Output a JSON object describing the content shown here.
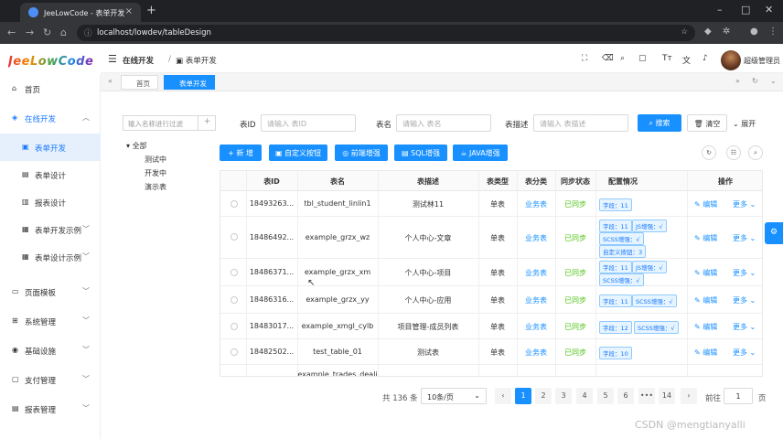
{
  "browser": {
    "tab_title": "JeeLowCode - 表单开发",
    "url": "localhost/lowdev/tableDesign"
  },
  "app": {
    "logo": "JeeLowCode",
    "breadcrumb": [
      "在线开发",
      "表单开发"
    ],
    "user_name": "超级管理员",
    "page_tabs": [
      "首页",
      "表单开发"
    ],
    "accent_color": "#1890ff"
  },
  "sidebar": {
    "items": [
      {
        "label": "首页",
        "icon": "home-icon"
      },
      {
        "label": "在线开发",
        "icon": "layers-icon",
        "expanded": true
      },
      {
        "label": "表单开发",
        "icon": "form-icon",
        "active": true
      },
      {
        "label": "表单设计",
        "icon": "design-icon"
      },
      {
        "label": "报表设计",
        "icon": "report-icon"
      },
      {
        "label": "表单开发示例",
        "icon": "grid-icon"
      },
      {
        "label": "表单设计示例",
        "icon": "grid-icon"
      },
      {
        "label": "页面模板",
        "icon": "template-icon"
      },
      {
        "label": "系统管理",
        "icon": "apps-icon"
      },
      {
        "label": "基础设施",
        "icon": "infra-icon"
      },
      {
        "label": "支付管理",
        "icon": "pay-icon"
      },
      {
        "label": "报表管理",
        "icon": "report-mgmt-icon"
      }
    ]
  },
  "tree": {
    "search_placeholder": "输入名称进行过滤",
    "nodes": [
      "全部",
      "测试中",
      "开发中",
      "演示表"
    ]
  },
  "filters": {
    "table_id_label": "表ID",
    "table_id_placeholder": "请输入 表ID",
    "table_name_label": "表名",
    "table_name_placeholder": "请输入 表名",
    "table_desc_label": "表描述",
    "table_desc_placeholder": "请输入 表描述",
    "search_button": "搜索",
    "clear_button": "清空",
    "expand_button": "展开"
  },
  "toolbar": {
    "new_button": "+ 新 增",
    "custom_button": "自定义按钮",
    "frontend_button": "前端增强",
    "sql_button": "SQL增强",
    "java_button": "JAVA增强"
  },
  "table": {
    "headers": [
      "表ID",
      "表名",
      "表描述",
      "表类型",
      "表分类",
      "同步状态",
      "配置情况",
      "操作"
    ],
    "rows": [
      {
        "id": "18493263...",
        "name": "tbl_student_linlin1",
        "desc": "测试林11",
        "type": "单表",
        "category": "业务表",
        "sync": "已同步",
        "tags": [
          "字段：11"
        ]
      },
      {
        "id": "18486492...",
        "name": "example_grzx_wz",
        "desc": "个人中心-文章",
        "type": "单表",
        "category": "业务表",
        "sync": "已同步",
        "tags": [
          "字段：11",
          "JS增强：√",
          "SCSS增强：√",
          "自定义按钮：3"
        ]
      },
      {
        "id": "18486371...",
        "name": "example_grzx_xm",
        "desc": "个人中心-项目",
        "type": "单表",
        "category": "业务表",
        "sync": "已同步",
        "tags": [
          "字段：11",
          "JS增强：√",
          "SCSS增强：√"
        ]
      },
      {
        "id": "18486316...",
        "name": "example_grzx_yy",
        "desc": "个人中心-应用",
        "type": "单表",
        "category": "业务表",
        "sync": "已同步",
        "tags": [
          "字段：11",
          "SCSS增强：√"
        ]
      },
      {
        "id": "18483017...",
        "name": "example_xmgl_cylb",
        "desc": "项目管理-成员列表",
        "type": "单表",
        "category": "业务表",
        "sync": "已同步",
        "tags": [
          "字段：12",
          "SCSS增强：√"
        ]
      },
      {
        "id": "18482502...",
        "name": "test_table_01",
        "desc": "测试表",
        "type": "单表",
        "category": "业务表",
        "sync": "已同步",
        "tags": [
          "字段：10"
        ]
      },
      {
        "id": "",
        "name": "example_trades_deali",
        "desc": "",
        "type": "",
        "category": "",
        "sync": "",
        "tags": []
      }
    ],
    "edit_label": "编辑",
    "more_label": "更多"
  },
  "pagination": {
    "total": "共 136 条",
    "page_size": "10条/页",
    "pages": [
      "1",
      "2",
      "3",
      "4",
      "5",
      "6",
      "•••",
      "14"
    ],
    "current": "1",
    "goto_label": "前往",
    "goto_value": "1",
    "page_suffix": "页"
  },
  "watermark": "CSDN @mengtianyalli"
}
